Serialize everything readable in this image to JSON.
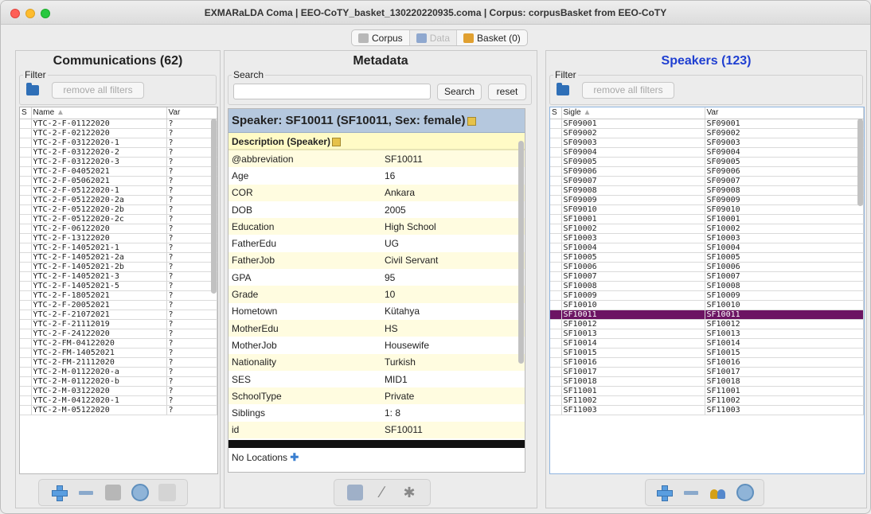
{
  "window": {
    "title": "EXMARaLDA Coma | EEO-CoTY_basket_130220220935.coma | Corpus: corpusBasket from EEO-CoTY"
  },
  "toolbar": {
    "corpus_label": "Corpus",
    "data_label": "Data",
    "basket_label": "Basket (0)"
  },
  "communications": {
    "title": "Communications (62)",
    "filter_label": "Filter",
    "remove_filters": "remove all filters",
    "headers": {
      "s": "S",
      "name": "Name",
      "var": "Var"
    },
    "rows": [
      {
        "name": "YTC-2-F-01122020",
        "var": "?"
      },
      {
        "name": "YTC-2-F-02122020",
        "var": "?"
      },
      {
        "name": "YTC-2-F-03122020-1",
        "var": "?"
      },
      {
        "name": "YTC-2-F-03122020-2",
        "var": "?"
      },
      {
        "name": "YTC-2-F-03122020-3",
        "var": "?"
      },
      {
        "name": "YTC-2-F-04052021",
        "var": "?"
      },
      {
        "name": "YTC-2-F-05062021",
        "var": "?"
      },
      {
        "name": "YTC-2-F-05122020-1",
        "var": "?"
      },
      {
        "name": "YTC-2-F-05122020-2a",
        "var": "?"
      },
      {
        "name": "YTC-2-F-05122020-2b",
        "var": "?"
      },
      {
        "name": "YTC-2-F-05122020-2c",
        "var": "?"
      },
      {
        "name": "YTC-2-F-06122020",
        "var": "?"
      },
      {
        "name": "YTC-2-F-13122020",
        "var": "?"
      },
      {
        "name": "YTC-2-F-14052021-1",
        "var": "?"
      },
      {
        "name": "YTC-2-F-14052021-2a",
        "var": "?"
      },
      {
        "name": "YTC-2-F-14052021-2b",
        "var": "?"
      },
      {
        "name": "YTC-2-F-14052021-3",
        "var": "?"
      },
      {
        "name": "YTC-2-F-14052021-5",
        "var": "?"
      },
      {
        "name": "YTC-2-F-18052021",
        "var": "?"
      },
      {
        "name": "YTC-2-F-20052021",
        "var": "?"
      },
      {
        "name": "YTC-2-F-21072021",
        "var": "?"
      },
      {
        "name": "YTC-2-F-21112019",
        "var": "?"
      },
      {
        "name": "YTC-2-F-24122020",
        "var": "?"
      },
      {
        "name": "YTC-2-FM-04122020",
        "var": "?"
      },
      {
        "name": "YTC-2-FM-14052021",
        "var": "?"
      },
      {
        "name": "YTC-2-FM-21112020",
        "var": "?"
      },
      {
        "name": "YTC-2-M-01122020-a",
        "var": "?"
      },
      {
        "name": "YTC-2-M-01122020-b",
        "var": "?"
      },
      {
        "name": "YTC-2-M-03122020",
        "var": "?"
      },
      {
        "name": "YTC-2-M-04122020-1",
        "var": "?"
      },
      {
        "name": "YTC-2-M-05122020",
        "var": "?"
      }
    ]
  },
  "metadata": {
    "title": "Metadata",
    "search_label": "Search",
    "search_value": "",
    "search_button": "Search",
    "reset_button": "reset",
    "speaker_heading": "Speaker: SF10011 (SF10011, Sex: female)",
    "description_heading": "Description (Speaker)",
    "fields": [
      {
        "key": "@abbreviation",
        "value": "SF10011"
      },
      {
        "key": "Age",
        "value": "16"
      },
      {
        "key": "COR",
        "value": "Ankara"
      },
      {
        "key": "DOB",
        "value": "2005"
      },
      {
        "key": "Education",
        "value": "High School"
      },
      {
        "key": "FatherEdu",
        "value": "UG"
      },
      {
        "key": "FatherJob",
        "value": "Civil Servant"
      },
      {
        "key": "GPA",
        "value": "95"
      },
      {
        "key": "Grade",
        "value": "10"
      },
      {
        "key": "Hometown",
        "value": "Kütahya"
      },
      {
        "key": "MotherEdu",
        "value": "HS"
      },
      {
        "key": "MotherJob",
        "value": "Housewife"
      },
      {
        "key": "Nationality",
        "value": "Turkish"
      },
      {
        "key": "SES",
        "value": "MID1"
      },
      {
        "key": "SchoolType",
        "value": "Private"
      },
      {
        "key": "Siblings",
        "value": "1: 8"
      },
      {
        "key": "id",
        "value": "SF10011"
      }
    ],
    "no_locations": "No Locations"
  },
  "speakers": {
    "title": "Speakers (123)",
    "filter_label": "Filter",
    "remove_filters": "remove all filters",
    "headers": {
      "s": "S",
      "sigle": "Sigle",
      "var": "Var"
    },
    "selected": "SF10011",
    "rows": [
      {
        "sigle": "SF09001",
        "var": "SF09001"
      },
      {
        "sigle": "SF09002",
        "var": "SF09002"
      },
      {
        "sigle": "SF09003",
        "var": "SF09003"
      },
      {
        "sigle": "SF09004",
        "var": "SF09004"
      },
      {
        "sigle": "SF09005",
        "var": "SF09005"
      },
      {
        "sigle": "SF09006",
        "var": "SF09006"
      },
      {
        "sigle": "SF09007",
        "var": "SF09007"
      },
      {
        "sigle": "SF09008",
        "var": "SF09008"
      },
      {
        "sigle": "SF09009",
        "var": "SF09009"
      },
      {
        "sigle": "SF09010",
        "var": "SF09010"
      },
      {
        "sigle": "SF10001",
        "var": "SF10001"
      },
      {
        "sigle": "SF10002",
        "var": "SF10002"
      },
      {
        "sigle": "SF10003",
        "var": "SF10003"
      },
      {
        "sigle": "SF10004",
        "var": "SF10004"
      },
      {
        "sigle": "SF10005",
        "var": "SF10005"
      },
      {
        "sigle": "SF10006",
        "var": "SF10006"
      },
      {
        "sigle": "SF10007",
        "var": "SF10007"
      },
      {
        "sigle": "SF10008",
        "var": "SF10008"
      },
      {
        "sigle": "SF10009",
        "var": "SF10009"
      },
      {
        "sigle": "SF10010",
        "var": "SF10010"
      },
      {
        "sigle": "SF10011",
        "var": "SF10011"
      },
      {
        "sigle": "SF10012",
        "var": "SF10012"
      },
      {
        "sigle": "SF10013",
        "var": "SF10013"
      },
      {
        "sigle": "SF10014",
        "var": "SF10014"
      },
      {
        "sigle": "SF10015",
        "var": "SF10015"
      },
      {
        "sigle": "SF10016",
        "var": "SF10016"
      },
      {
        "sigle": "SF10017",
        "var": "SF10017"
      },
      {
        "sigle": "SF10018",
        "var": "SF10018"
      },
      {
        "sigle": "SF11001",
        "var": "SF11001"
      },
      {
        "sigle": "SF11002",
        "var": "SF11002"
      },
      {
        "sigle": "SF11003",
        "var": "SF11003"
      }
    ]
  },
  "colors": {
    "selection": "#6c1463",
    "speakers_title": "#1f3fd1",
    "speaker_header_bg": "#b5c8de",
    "description_bg": "#fffbc6"
  }
}
